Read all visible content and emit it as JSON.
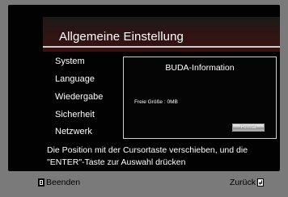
{
  "header": {
    "title": "Allgemeine Einstellung"
  },
  "menu": {
    "items": [
      {
        "label": "System"
      },
      {
        "label": "Language"
      },
      {
        "label": "Wiedergabe"
      },
      {
        "label": "Sicherheit"
      },
      {
        "label": "Netzwerk"
      }
    ]
  },
  "panel": {
    "title": "BUDA-Information",
    "free_size": "Freie Größe : 0MB",
    "format_label": "Format"
  },
  "help": {
    "text": "Die Position mit der Cursortaste verschieben, und die \"ENTER\"-Taste zur Auswahl drücken"
  },
  "footer": {
    "exit_label": "Beenden",
    "back_label": "Zurück",
    "exit_icon": "exit-key-icon",
    "back_icon": "return-key-icon"
  },
  "colors": {
    "background": "#7a7a7a",
    "screen": "#020202",
    "header_accent": "#3a1212",
    "text": "#ffffff"
  }
}
